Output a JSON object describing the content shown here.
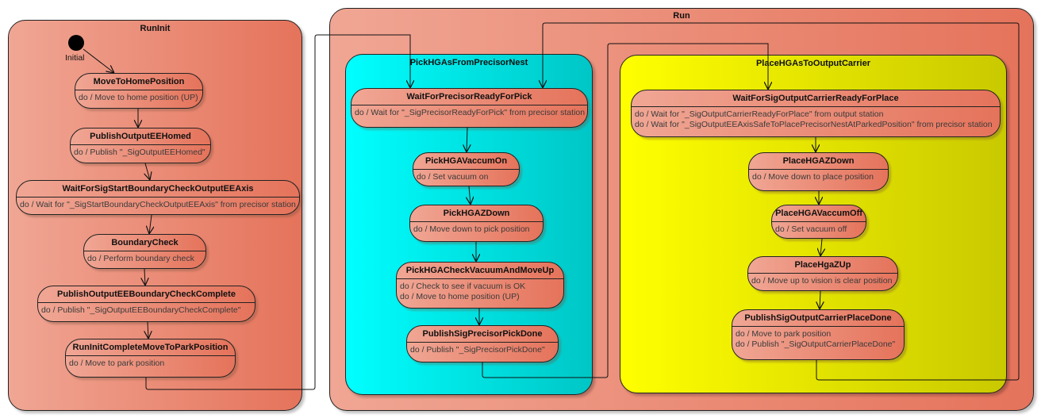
{
  "run_init": {
    "title": "RunInit",
    "initial_label": "Initial",
    "states": [
      {
        "name": "MoveToHomePosition",
        "actions": [
          "do / Move to home position (UP)"
        ]
      },
      {
        "name": "PublishOutputEEHomed",
        "actions": [
          "do / Publish \"_SigOutputEEHomed\""
        ]
      },
      {
        "name": "WaitForSigStartBoundaryCheckOutputEEAxis",
        "actions": [
          "do / Wait for \"_SigStartBoundaryCheckOutputEEAxis\" from precisor station"
        ]
      },
      {
        "name": "BoundaryCheck",
        "actions": [
          "do / Perform boundary check"
        ]
      },
      {
        "name": "PublishOutputEEBoundaryCheckComplete",
        "actions": [
          "do / Publish \"_SigOutputEEBoundaryCheckComplete\""
        ]
      },
      {
        "name": "RunInitCompleteMoveToParkPosition",
        "actions": [
          "do / Move to park position"
        ]
      }
    ]
  },
  "run": {
    "title": "Run",
    "pick": {
      "title": "PickHGAsFromPrecisorNest",
      "color": "#00ffff",
      "states": [
        {
          "name": "WaitForPrecisorReadyForPick",
          "actions": [
            "do / Wait for \"_SigPrecisorReadyForPick\" from precisor station"
          ]
        },
        {
          "name": "PickHGAVaccumOn",
          "actions": [
            "do / Set vacuum on"
          ]
        },
        {
          "name": "PickHGAZDown",
          "actions": [
            "do / Move down to pick position"
          ]
        },
        {
          "name": "PickHGACheckVacuumAndMoveUp",
          "actions": [
            "do / Check to see if vacuum is OK",
            "do / Move to home position (UP)"
          ]
        },
        {
          "name": "PublishSigPrecisorPickDone",
          "actions": [
            "do / Publish \"_SigPrecisorPickDone\""
          ]
        }
      ]
    },
    "place": {
      "title": "PlaceHGAsToOutputCarrier",
      "color": "#ffff00",
      "states": [
        {
          "name": "WaitForSigOutputCarrierReadyForPlace",
          "actions": [
            "do / Wait for \"_SigOutputCarrierReadyForPlace\" from output station",
            "do / Wait for \"_SigOutputEEAxisSafeToPlacePrecisorNestAtParkedPosition\" from precisor station"
          ]
        },
        {
          "name": "PlaceHGAZDown",
          "actions": [
            "do / Move down to place position"
          ]
        },
        {
          "name": "PlaceHGAVaccumOff",
          "actions": [
            "do / Set vacuum off"
          ]
        },
        {
          "name": "PlaceHgaZUp",
          "actions": [
            "do / Move up to vision is clear position"
          ]
        },
        {
          "name": "PublishSigOutputCarrierPlaceDone",
          "actions": [
            "do / Move to park position",
            "do / Publish \"_SigOutputCarrierPlaceDone\""
          ]
        }
      ]
    }
  },
  "colors": {
    "state": "#e5735b",
    "state_light": "#f0a694",
    "pick_region": "#00ffff",
    "place_region": "#ffff00"
  }
}
